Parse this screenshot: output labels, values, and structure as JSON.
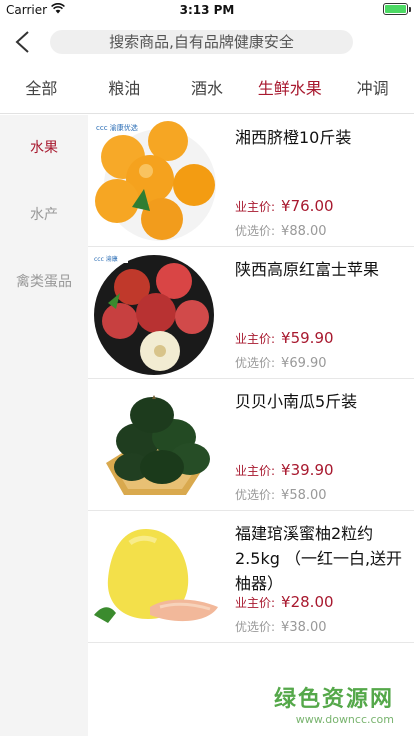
{
  "status": {
    "carrier": "Carrier",
    "time": "3:13 PM"
  },
  "search": {
    "placeholder": "搜索商品,自有品牌健康安全"
  },
  "tabs": [
    {
      "label": "全部",
      "active": false
    },
    {
      "label": "粮油",
      "active": false
    },
    {
      "label": "酒水",
      "active": false
    },
    {
      "label": "生鲜水果",
      "active": true
    },
    {
      "label": "冲调",
      "active": false
    }
  ],
  "sidebar": [
    {
      "label": "水果",
      "active": true
    },
    {
      "label": "水产",
      "active": false
    },
    {
      "label": "禽类蛋品",
      "active": false
    }
  ],
  "labels": {
    "member_price": "业主价:",
    "original_price": "优选价:"
  },
  "products": [
    {
      "title": "湘西脐橙10斤装",
      "price": "¥76.00",
      "orig": "¥88.00",
      "icon": "orange-icon"
    },
    {
      "title": "陕西高原红富士苹果",
      "price": "¥59.90",
      "orig": "¥69.90",
      "icon": "apple-icon"
    },
    {
      "title": "贝贝小南瓜5斤装",
      "price": "¥39.90",
      "orig": "¥58.00",
      "icon": "pumpkin-icon"
    },
    {
      "title": "福建琯溪蜜柚2粒约2.5kg （一红一白,送开柚器）",
      "price": "¥28.00",
      "orig": "¥38.00",
      "icon": "pomelo-icon"
    }
  ],
  "watermark": {
    "title": "绿色资源网",
    "url": "www.downcc.com"
  },
  "colors": {
    "accent": "#a8192f",
    "battery": "#4cd964",
    "watermark": "#55a84a"
  }
}
